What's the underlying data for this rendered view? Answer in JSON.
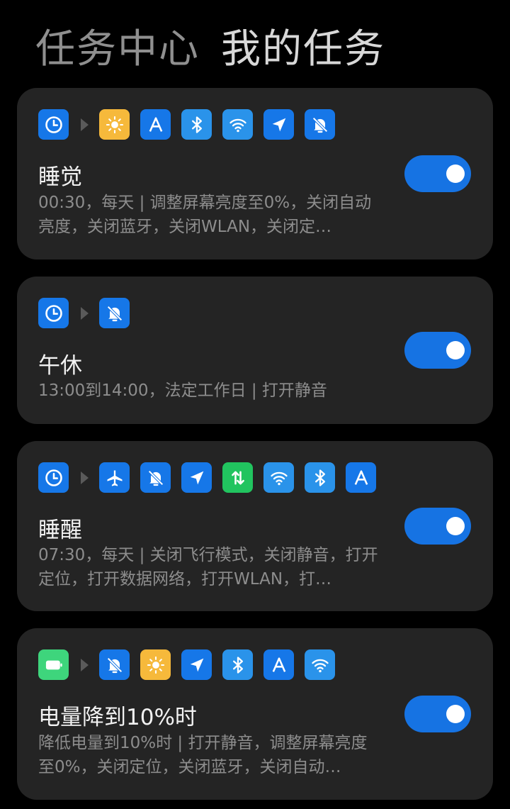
{
  "header": {
    "tab_inactive": "任务中心",
    "tab_active": "我的任务"
  },
  "tasks": [
    {
      "title": "睡觉",
      "desc": "00:30，每天 | 调整屏幕亮度至0%，关闭自动亮度，关闭蓝牙，关闭WLAN，关闭定…",
      "enabled": true,
      "trigger_icon": "clock-icon",
      "action_icons": [
        "brightness-icon",
        "auto-brightness-icon",
        "bluetooth-icon",
        "wifi-icon",
        "location-icon",
        "mute-icon"
      ]
    },
    {
      "title": "午休",
      "desc": "13:00到14:00，法定工作日 | 打开静音",
      "enabled": true,
      "trigger_icon": "clock-icon",
      "action_icons": [
        "mute-icon"
      ]
    },
    {
      "title": "睡醒",
      "desc": "07:30，每天 | 关闭飞行模式，关闭静音，打开定位，打开数据网络，打开WLAN，打…",
      "enabled": true,
      "trigger_icon": "clock-icon",
      "action_icons": [
        "airplane-icon",
        "mute-icon",
        "location-icon",
        "mobile-data-icon",
        "wifi-icon",
        "bluetooth-icon",
        "auto-brightness-icon"
      ]
    },
    {
      "title": "电量降到10%时",
      "desc": "降低电量到10%时 | 打开静音，调整屏幕亮度至0%，关闭定位，关闭蓝牙，关闭自动…",
      "enabled": true,
      "trigger_icon": "battery-icon",
      "action_icons": [
        "mute-icon",
        "brightness-icon",
        "location-icon",
        "bluetooth-icon",
        "auto-brightness-icon",
        "wifi-icon"
      ]
    }
  ],
  "colors": {
    "background": "#000000",
    "card": "#242424",
    "accent_blue": "#1677e8",
    "toggle_on": "#1673e3",
    "yellow": "#f6b93b",
    "green": "#21c45f"
  }
}
